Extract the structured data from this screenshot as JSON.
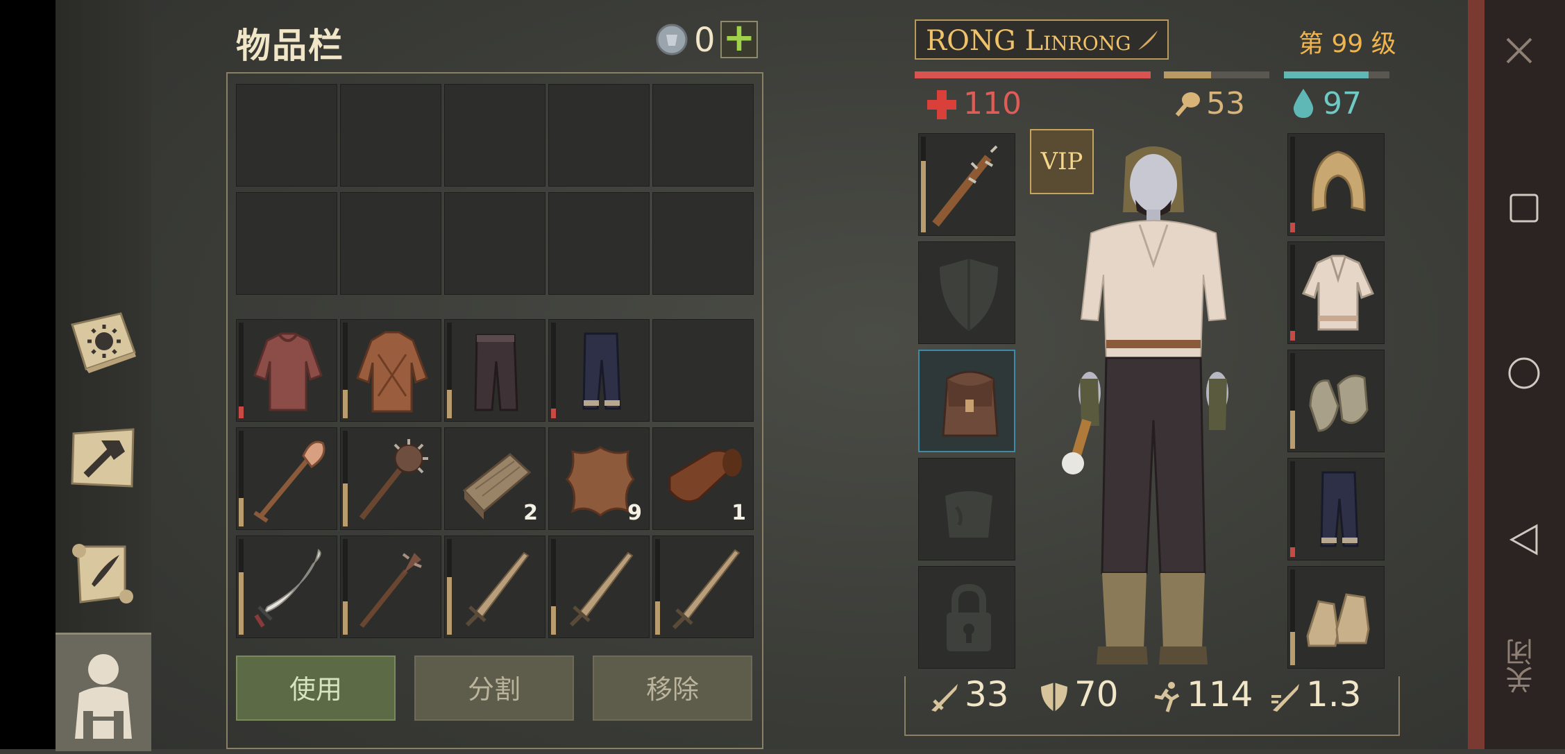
{
  "inventory": {
    "title": "物品栏",
    "currency": "0",
    "add_label": "+",
    "storage_slots": [
      {},
      {},
      {},
      {},
      {},
      {},
      {},
      {},
      {},
      {}
    ],
    "items": [
      {
        "name": "chainmail-shirt-icon",
        "durability": 0.12,
        "bar_color": "#c84a44"
      },
      {
        "name": "padded-jacket-icon",
        "durability": 0.3,
        "bar_color": "#b99d6e"
      },
      {
        "name": "leather-pants-icon",
        "durability": 0.3,
        "bar_color": "#b99d6e"
      },
      {
        "name": "cloth-pants-icon",
        "durability": 0.1,
        "bar_color": "#c84a44"
      },
      {
        "name": "empty-slot"
      },
      {
        "name": "shovel-icon",
        "durability": 0.3,
        "bar_color": "#b99d6e"
      },
      {
        "name": "morning-star-mace-icon",
        "durability": 0.45,
        "bar_color": "#b99d6e"
      },
      {
        "name": "wood-planks-icon",
        "count": "2"
      },
      {
        "name": "animal-hide-icon",
        "count": "9"
      },
      {
        "name": "leather-roll-icon",
        "count": "1"
      },
      {
        "name": "scimitar-icon",
        "durability": 0.65,
        "bar_color": "#b99d6e"
      },
      {
        "name": "spiked-mace-icon",
        "durability": 0.35,
        "bar_color": "#b99d6e"
      },
      {
        "name": "short-sword-icon",
        "durability": 0.6,
        "bar_color": "#b99d6e"
      },
      {
        "name": "short-sword-icon",
        "durability": 0.3,
        "bar_color": "#b99d6e"
      },
      {
        "name": "long-sword-icon",
        "durability": 0.35,
        "bar_color": "#b99d6e"
      }
    ],
    "buttons": {
      "use": "使用",
      "split": "分割",
      "remove": "移除"
    }
  },
  "character": {
    "name": "RONG Linrong",
    "level": "第 99 级",
    "health": "110",
    "food": "53",
    "water": "97",
    "health_fill": 1.0,
    "food_fill": 0.45,
    "water_fill": 0.8,
    "vip_label": "VIP",
    "colors": {
      "health": "#d95450",
      "food": "#b89a62",
      "water": "#5fb8b6",
      "gold": "#f0c26a"
    },
    "stats": {
      "attack": "33",
      "defense": "70",
      "speed": "114",
      "attack_speed": "1.3"
    }
  },
  "system": {
    "close_label": "关闭"
  }
}
